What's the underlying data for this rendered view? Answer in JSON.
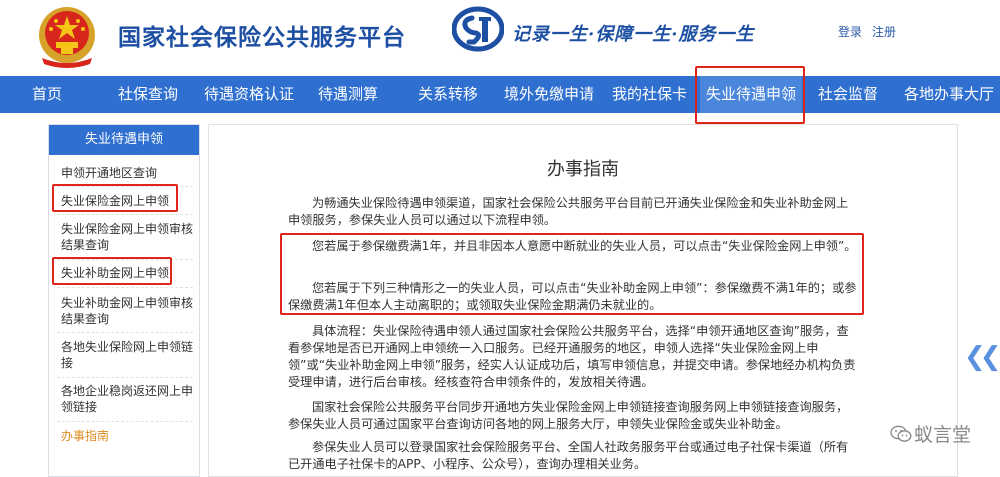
{
  "header": {
    "site_title": "国家社会保险公共服务平台",
    "slogan": "记录一生·保障一生·服务一生",
    "login": "登录",
    "register": "注册"
  },
  "nav": {
    "items": [
      "首页",
      "社保查询",
      "待遇资格认证",
      "待遇测算",
      "关系转移",
      "境外免缴申请",
      "我的社保卡",
      "失业待遇申领",
      "社会监督",
      "各地办事大厅"
    ],
    "active_index": 7
  },
  "sidebar": {
    "title": "失业待遇申领",
    "items": [
      "申领开通地区查询",
      "失业保险金网上申领",
      "失业保险金网上申领审核结果查询",
      "失业补助金网上申领",
      "失业补助金网上申领审核结果查询",
      "各地失业保险网上申领链接",
      "各地企业稳岗返还网上申领链接",
      "办事指南"
    ],
    "active_index": 7
  },
  "main": {
    "title": "办事指南",
    "paragraphs": [
      "为畅通失业保险待遇申领渠道，国家社会保险公共服务平台目前已开通失业保险金和失业补助金网上申领服务，参保失业人员可以通过以下流程申领。",
      "您若属于参保缴费满1年，并且非因本人意愿中断就业的失业人员，可以点击“失业保险金网上申领”。",
      "您若属于下列三种情形之一的失业人员，可以点击“失业补助金网上申领”：参保缴费不满1年的；或参保缴费满1年但本人主动离职的；或领取失业保险金期满仍未就业的。",
      "具体流程：失业保险待遇申领人通过国家社会保险公共服务平台，选择“申领开通地区查询”服务，查看参保地是否已开通网上申领统一入口服务。已经开通服务的地区，申领人选择“失业保险金网上申领”或“失业补助金网上申领”服务，经实人认证成功后，填写申领信息，并提交申请。参保地经办机构负责受理申请，进行后台审核。经核查符合申领条件的，发放相关待遇。",
      "国家社会保险公共服务平台同步开通地方失业保险金网上申领链接查询服务网上申领链接查询服务，参保失业人员可通过国家平台查询访问各地的网上服务大厅，申领失业保险金或失业补助金。",
      "参保失业人员可以登录国家社会保险服务平台、全国人社政务服务平台或通过电子社保卡渠道（所有已开通电子社保卡的APP、小程序、公众号），查询办理相关业务。"
    ]
  },
  "watermark": "蚁言堂",
  "colors": {
    "nav_bg": "#2f6fd0",
    "brand_blue": "#1d4fa3",
    "highlight_red": "#e0241b",
    "active_orange": "#e08a1e"
  }
}
